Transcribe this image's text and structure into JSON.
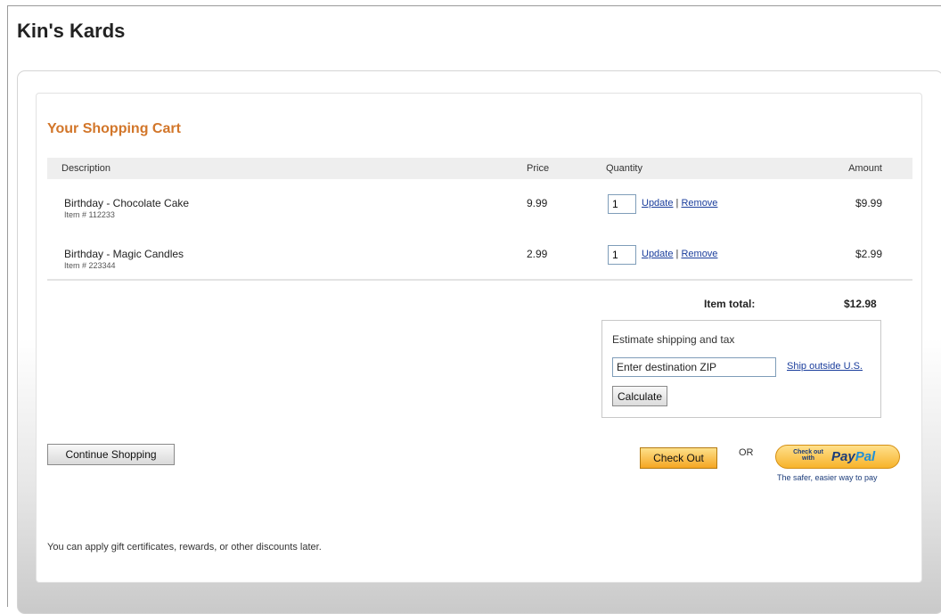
{
  "site": {
    "title": "Kin's Kards"
  },
  "cart": {
    "title": "Your Shopping Cart",
    "columns": {
      "description": "Description",
      "price": "Price",
      "quantity": "Quantity",
      "amount": "Amount"
    },
    "items": [
      {
        "description": "Birthday - Chocolate Cake",
        "item_no": "Item # 112233",
        "price": "9.99",
        "quantity": "1",
        "update_label": "Update",
        "separator": "|",
        "remove_label": "Remove",
        "amount": "$9.99"
      },
      {
        "description": "Birthday - Magic Candles",
        "item_no": "Item # 223344",
        "price": "2.99",
        "quantity": "1",
        "update_label": "Update",
        "separator": "|",
        "remove_label": "Remove",
        "amount": "$2.99"
      }
    ],
    "item_total_label": "Item total:",
    "item_total_value": "$12.98"
  },
  "shipping": {
    "title": "Estimate shipping and tax",
    "zip_value": "Enter destination ZIP",
    "outside_label": "Ship outside U.S.",
    "calculate_label": "Calculate"
  },
  "actions": {
    "continue_label": "Continue Shopping",
    "checkout_label": "Check Out",
    "or_label": "OR",
    "paypal_small": "Check out with",
    "paypal_pay": "Pay",
    "paypal_pal": "Pal",
    "paypal_tagline": "The safer, easier way to pay"
  },
  "footnote": "You can apply gift certificates, rewards, or other discounts later.",
  "colors": {
    "accent_orange": "#d2762a",
    "link_blue": "#1a3d9c",
    "checkout_orange": "#f5a623"
  }
}
